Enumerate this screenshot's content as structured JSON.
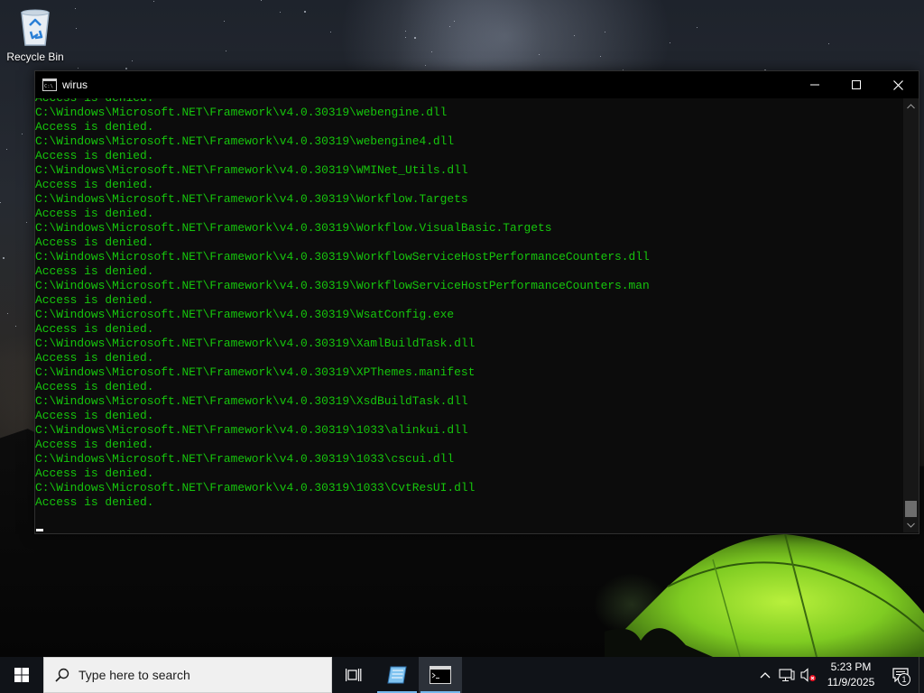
{
  "desktop": {
    "recycle_bin_label": "Recycle Bin"
  },
  "window": {
    "title": "wirus",
    "icon": "cmd-icon",
    "controls": [
      "minimize-icon",
      "maximize-icon",
      "close-icon"
    ]
  },
  "console": {
    "text_color": "#16C60C",
    "background": "#0C0C0C",
    "lines": [
      "Access is denied.",
      "C:\\Windows\\Microsoft.NET\\Framework\\v4.0.30319\\webengine.dll",
      "Access is denied.",
      "C:\\Windows\\Microsoft.NET\\Framework\\v4.0.30319\\webengine4.dll",
      "Access is denied.",
      "C:\\Windows\\Microsoft.NET\\Framework\\v4.0.30319\\WMINet_Utils.dll",
      "Access is denied.",
      "C:\\Windows\\Microsoft.NET\\Framework\\v4.0.30319\\Workflow.Targets",
      "Access is denied.",
      "C:\\Windows\\Microsoft.NET\\Framework\\v4.0.30319\\Workflow.VisualBasic.Targets",
      "Access is denied.",
      "C:\\Windows\\Microsoft.NET\\Framework\\v4.0.30319\\WorkflowServiceHostPerformanceCounters.dll",
      "Access is denied.",
      "C:\\Windows\\Microsoft.NET\\Framework\\v4.0.30319\\WorkflowServiceHostPerformanceCounters.man",
      "Access is denied.",
      "C:\\Windows\\Microsoft.NET\\Framework\\v4.0.30319\\WsatConfig.exe",
      "Access is denied.",
      "C:\\Windows\\Microsoft.NET\\Framework\\v4.0.30319\\XamlBuildTask.dll",
      "Access is denied.",
      "C:\\Windows\\Microsoft.NET\\Framework\\v4.0.30319\\XPThemes.manifest",
      "Access is denied.",
      "C:\\Windows\\Microsoft.NET\\Framework\\v4.0.30319\\XsdBuildTask.dll",
      "Access is denied.",
      "C:\\Windows\\Microsoft.NET\\Framework\\v4.0.30319\\1033\\alinkui.dll",
      "Access is denied.",
      "C:\\Windows\\Microsoft.NET\\Framework\\v4.0.30319\\1033\\cscui.dll",
      "Access is denied.",
      "C:\\Windows\\Microsoft.NET\\Framework\\v4.0.30319\\1033\\CvtResUI.dll",
      "Access is denied."
    ]
  },
  "taskbar": {
    "search_placeholder": "Type here to search",
    "apps": [
      {
        "icon": "task-view-icon",
        "active": false
      },
      {
        "icon": "notepad-app-icon",
        "active": false
      },
      {
        "icon": "cmd-icon",
        "active": true
      }
    ],
    "tray_icons": [
      "chevron-up-icon",
      "network-icon",
      "volume-muted-icon"
    ],
    "clock_time": "5:23 PM",
    "clock_date": "11/9/2025",
    "notification_count": "1",
    "accent_color": "#76B9ED"
  }
}
